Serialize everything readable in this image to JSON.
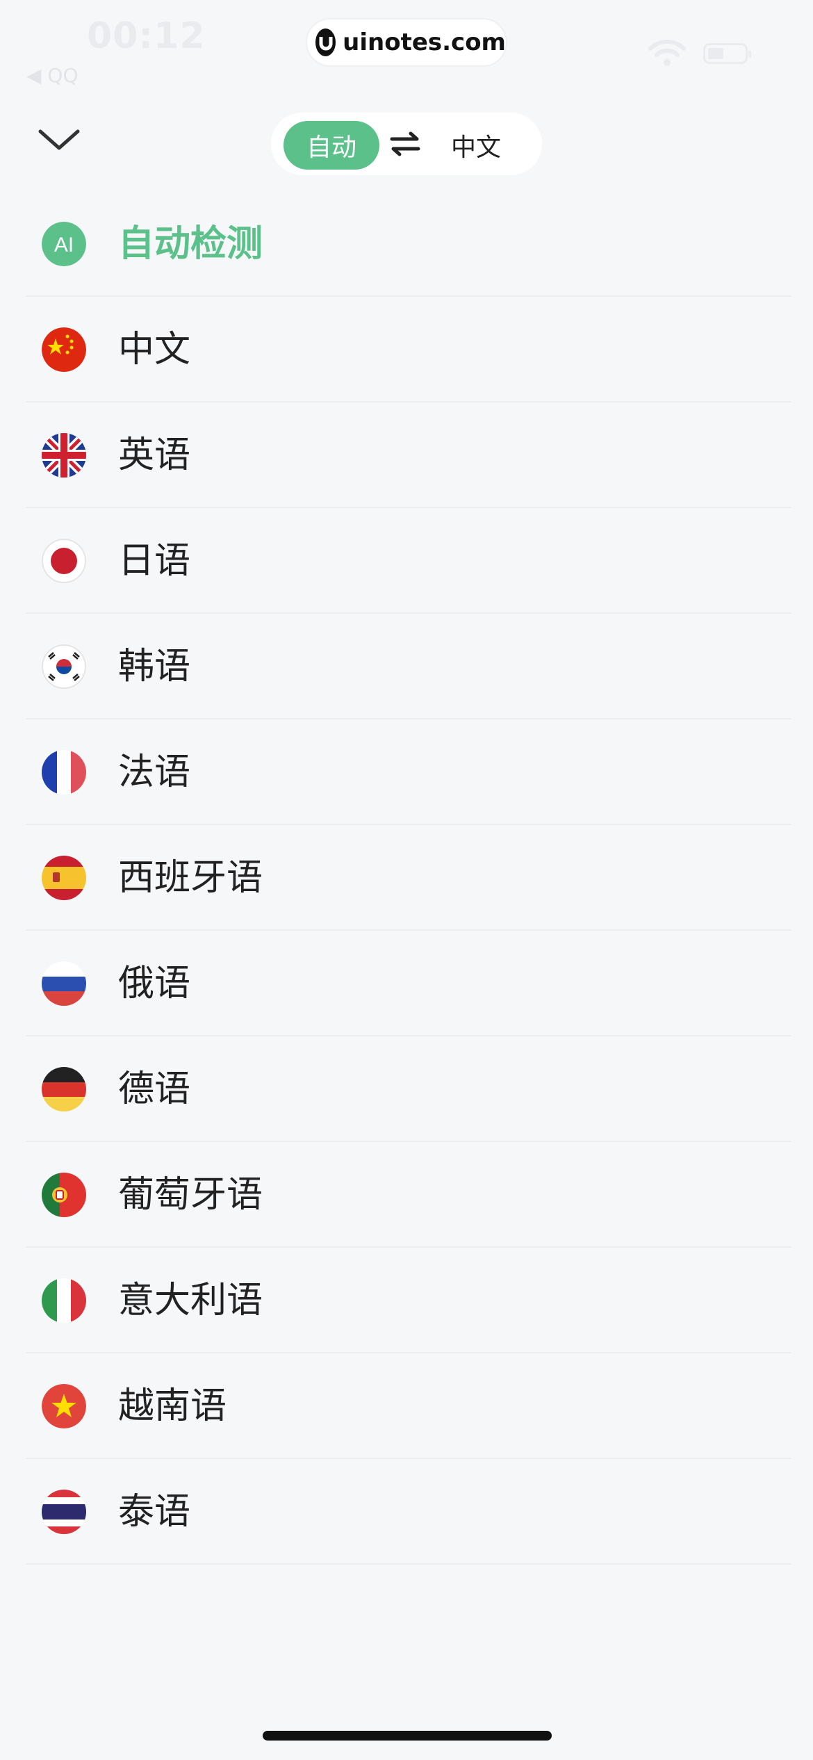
{
  "status_bar": {
    "time": "00:12",
    "back_app": "◀ QQ",
    "watermark": "uinotes.com"
  },
  "header": {
    "source_language": "自动",
    "target_language": "中文"
  },
  "colors": {
    "accent": "#5cc08a",
    "background": "#f6f7f9"
  },
  "languages": [
    {
      "label": "自动检测",
      "flag": "ai-icon",
      "active": true
    },
    {
      "label": "中文",
      "flag": "china-flag-icon"
    },
    {
      "label": "英语",
      "flag": "uk-flag-icon"
    },
    {
      "label": "日语",
      "flag": "japan-flag-icon"
    },
    {
      "label": "韩语",
      "flag": "korea-flag-icon"
    },
    {
      "label": "法语",
      "flag": "france-flag-icon"
    },
    {
      "label": "西班牙语",
      "flag": "spain-flag-icon"
    },
    {
      "label": "俄语",
      "flag": "russia-flag-icon"
    },
    {
      "label": "德语",
      "flag": "germany-flag-icon"
    },
    {
      "label": "葡萄牙语",
      "flag": "portugal-flag-icon"
    },
    {
      "label": "意大利语",
      "flag": "italy-flag-icon"
    },
    {
      "label": "越南语",
      "flag": "vietnam-flag-icon"
    },
    {
      "label": "泰语",
      "flag": "thailand-flag-icon"
    }
  ]
}
